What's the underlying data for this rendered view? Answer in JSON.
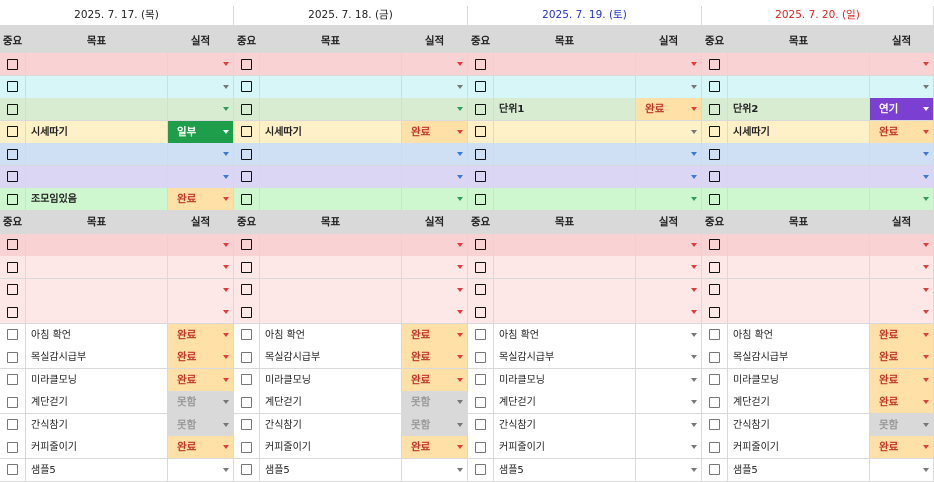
{
  "days": [
    {
      "label": "2025. 7. 17. (목)",
      "color": "#222222"
    },
    {
      "label": "2025. 7. 18. (금)",
      "color": "#222222"
    },
    {
      "label": "2025. 7. 19. (토)",
      "color": "#2233cc"
    },
    {
      "label": "2025. 7. 20. (일)",
      "color": "#dd2222"
    }
  ],
  "header_labels": {
    "importance": "중요",
    "goal": "목표",
    "result": "실적"
  },
  "status_labels": {
    "done": "완료",
    "partial": "일부",
    "fail": "못함",
    "postpone": "연기"
  },
  "colors": {
    "red": "#f9d3d3",
    "cyan": "#d6f6f8",
    "green": "#d7ecd0",
    "yellow": "#fff1c7",
    "blue": "#cfe0f5",
    "purple": "#dcd6f5",
    "mint": "#cff7cf",
    "header_gray": "#d9d9d9",
    "pink": "#fde7e7",
    "white": "#ffffff"
  },
  "section1": [
    {
      "bg": "red",
      "arrow": "red",
      "goals": [
        "",
        "",
        "",
        ""
      ],
      "results": [
        "",
        "",
        "",
        ""
      ]
    },
    {
      "bg": "cyan",
      "arrow": "gray",
      "goals": [
        "",
        "",
        "",
        ""
      ],
      "results": [
        "",
        "",
        "",
        ""
      ]
    },
    {
      "bg": "green",
      "arrow": "green",
      "goals": [
        "",
        "",
        "단위1",
        "단위2"
      ],
      "results": [
        "",
        "",
        "done",
        "postpone"
      ]
    },
    {
      "bg": "yellow",
      "arrow": "gray",
      "goals": [
        "시세따기",
        "시세따기",
        "",
        "시세따기"
      ],
      "results": [
        "partial",
        "done",
        "",
        "done"
      ]
    },
    {
      "bg": "blue",
      "arrow": "blue",
      "goals": [
        "",
        "",
        "",
        ""
      ],
      "results": [
        "",
        "",
        "",
        ""
      ]
    },
    {
      "bg": "purple",
      "arrow": "blue",
      "goals": [
        "",
        "",
        "",
        ""
      ],
      "results": [
        "",
        "",
        "",
        ""
      ]
    },
    {
      "bg": "mint",
      "arrow": "green",
      "goals": [
        "조모임있음",
        "",
        "",
        ""
      ],
      "results": [
        "done",
        "",
        "",
        ""
      ]
    }
  ],
  "section2_pink_rows": 4,
  "routines": [
    {
      "name": "아침 확언",
      "results": [
        "done",
        "done",
        "",
        "done"
      ]
    },
    {
      "name": "목실감시급부",
      "results": [
        "done",
        "done",
        "",
        "done"
      ]
    },
    {
      "name": "미라클모닝",
      "results": [
        "done",
        "done",
        "",
        "done"
      ]
    },
    {
      "name": "계단걷기",
      "results": [
        "fail",
        "fail",
        "",
        "done"
      ]
    },
    {
      "name": "간식참기",
      "results": [
        "fail",
        "fail",
        "",
        "fail"
      ]
    },
    {
      "name": "커피줄이기",
      "results": [
        "done",
        "done",
        "",
        "done"
      ]
    },
    {
      "name": "샘플5",
      "results": [
        "",
        "",
        "",
        ""
      ]
    }
  ]
}
